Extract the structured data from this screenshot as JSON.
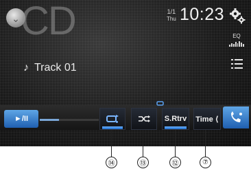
{
  "source": {
    "title": "CD",
    "button_icon": "chevron-down-icon"
  },
  "status": {
    "date": "1/1",
    "weekday": "Thu",
    "time": "10:23"
  },
  "side_controls": {
    "settings_icon": "gear-icon",
    "eq_label": "EQ",
    "list_icon": "list-icon"
  },
  "track": {
    "icon": "music-note-icon",
    "name": "Track 01"
  },
  "playback": {
    "play_pause_label": "►/II",
    "progress": 0.32
  },
  "function_buttons": [
    {
      "id": "repeat",
      "label": "",
      "icon": "repeat-icon"
    },
    {
      "id": "shuffle",
      "label": "",
      "icon": "shuffle-icon"
    },
    {
      "id": "sound-retriever",
      "label": "S.Rtrv"
    },
    {
      "id": "time",
      "label": "Time ⟨"
    }
  ],
  "phone_icon": "phone-icon",
  "callouts": [
    "⑭",
    "⑬",
    "⑫",
    "⑦"
  ],
  "colors": {
    "accent_blue": "#2f7fd6",
    "screen_bg": "#1c1c1c"
  }
}
